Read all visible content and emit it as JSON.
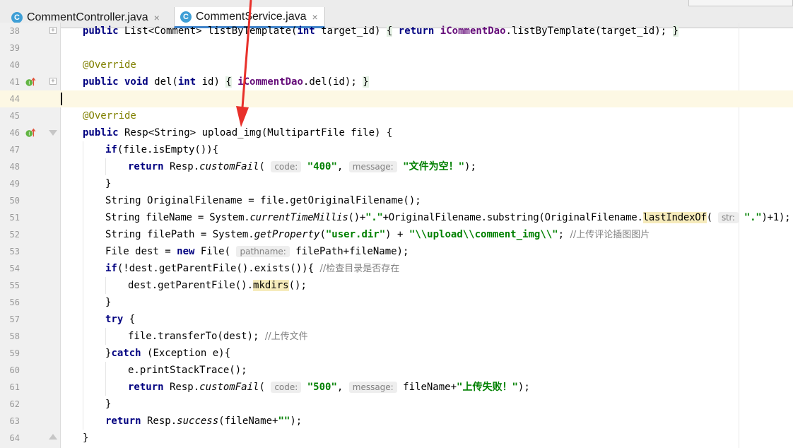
{
  "tabs": [
    {
      "label": "CommentController.java",
      "icon": "class-c-icon",
      "active": false
    },
    {
      "label": "CommentService.java",
      "icon": "class-c-icon",
      "active": true
    }
  ],
  "tab_close": "×",
  "class_icon_letter": "C",
  "lines": [
    {
      "n": "38",
      "text": "public List<Comment> listByTemplate(int target_id) { return iCommentDao.listByTemplate(target_id); }"
    },
    {
      "n": "39",
      "text": ""
    },
    {
      "n": "40",
      "text": "@Override"
    },
    {
      "n": "41",
      "text": "public void del(int id) { iCommentDao.del(id); }"
    },
    {
      "n": "44",
      "text": ""
    },
    {
      "n": "45",
      "text": "@Override"
    },
    {
      "n": "46",
      "text": "public Resp<String> upload_img(MultipartFile file) {"
    },
    {
      "n": "47",
      "text": "if(file.isEmpty()){"
    },
    {
      "n": "48",
      "text": "return Resp.customFail( code: \"400\", message: \"文件为空！\");"
    },
    {
      "n": "49",
      "text": "}"
    },
    {
      "n": "50",
      "text": "String OriginalFilename = file.getOriginalFilename();"
    },
    {
      "n": "51",
      "text": "String fileName = System.currentTimeMillis()+\".\"+OriginalFilename.substring(OriginalFilename.lastIndexOf( str: \".\")+1);"
    },
    {
      "n": "52",
      "text": "String filePath = System.getProperty(\"user.dir\") + \"\\\\upload\\\\comment_img\\\\\"; //上传评论插图图片"
    },
    {
      "n": "53",
      "text": "File dest = new File( pathname: filePath+fileName);"
    },
    {
      "n": "54",
      "text": "if(!dest.getParentFile().exists()){ //检查目录是否存在"
    },
    {
      "n": "55",
      "text": "dest.getParentFile().mkdirs();"
    },
    {
      "n": "56",
      "text": "}"
    },
    {
      "n": "57",
      "text": "try {"
    },
    {
      "n": "58",
      "text": "file.transferTo(dest); //上传文件"
    },
    {
      "n": "59",
      "text": "}catch (Exception e){"
    },
    {
      "n": "60",
      "text": "e.printStackTrace();"
    },
    {
      "n": "61",
      "text": "return Resp.customFail( code: \"500\", message: fileName+\"上传失败！\");"
    },
    {
      "n": "62",
      "text": "}"
    },
    {
      "n": "63",
      "text": "return Resp.success(fileName+\"\");"
    },
    {
      "n": "64",
      "text": "}"
    }
  ],
  "colors": {
    "keyword": "#000080",
    "annotation": "#808000",
    "string": "#008000",
    "field": "#660e7a",
    "arrow": "#e8302a",
    "tab_accent": "#4083c9"
  }
}
